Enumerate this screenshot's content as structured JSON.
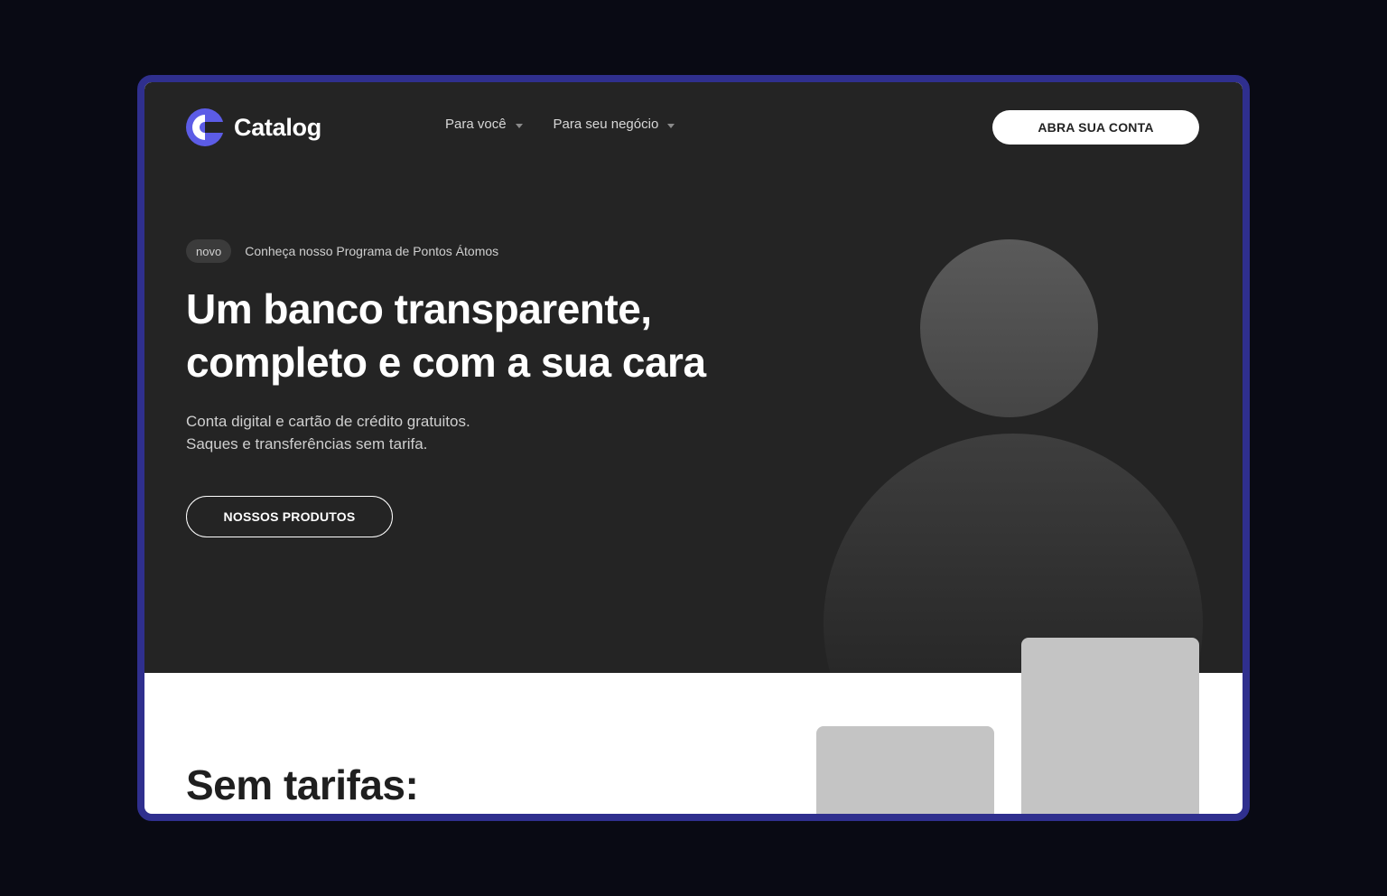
{
  "header": {
    "logo_text": "Catalog",
    "logo_icon": "catalog-c-logo",
    "nav": [
      {
        "label": "Para você",
        "icon": "chevron-down-icon"
      },
      {
        "label": "Para seu negócio",
        "icon": "chevron-down-icon"
      }
    ],
    "cta_label": "ABRA SUA CONTA"
  },
  "hero": {
    "badge": "novo",
    "announcement": "Conheça nosso Programa de Pontos Átomos",
    "headline": "Um banco transparente, completo e com a sua cara",
    "subtext_lines": [
      "Conta digital e cartão de crédito gratuitos.",
      "Saques e transferências sem tarifa."
    ],
    "cta_label": "NOSSOS PRODUTOS",
    "image": "person-placeholder"
  },
  "features": {
    "title": "Sem tarifas:"
  },
  "colors": {
    "page_bg": "#090a14",
    "frame_border": "#2f2f8e",
    "hero_bg": "#242424",
    "accent": "#5c5ce6",
    "placeholder": "#c4c4c4"
  }
}
